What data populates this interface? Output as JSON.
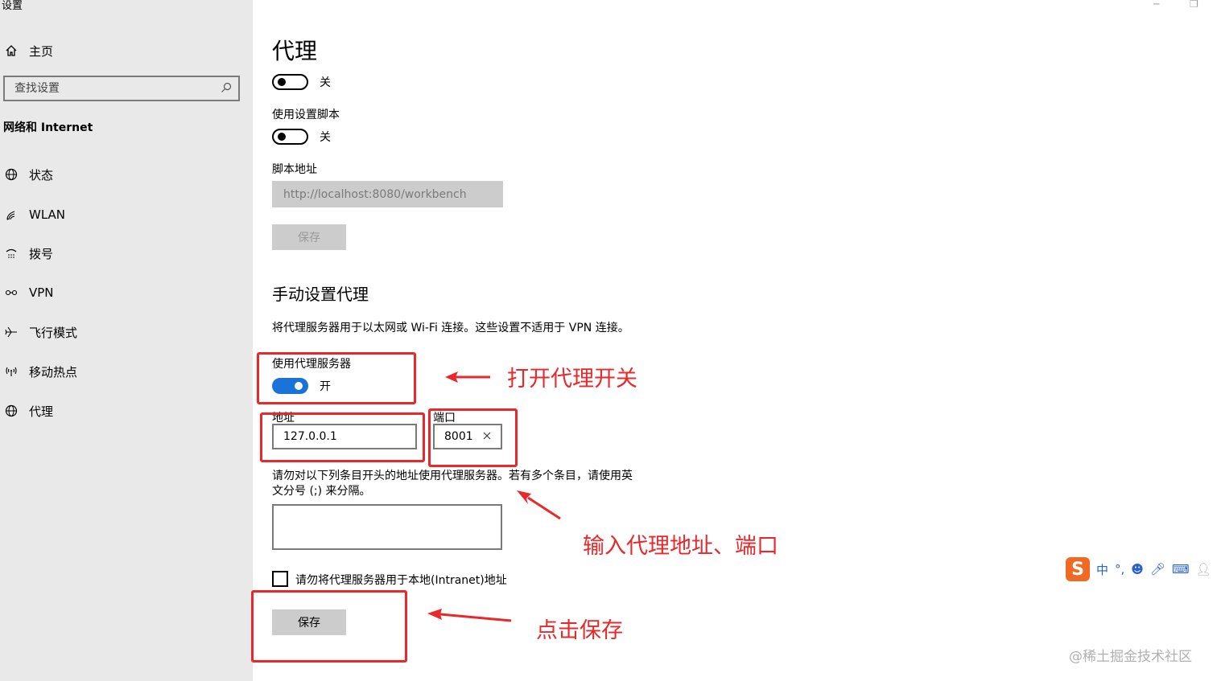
{
  "window": {
    "title": "设置",
    "minimize_icon": "minimize-icon",
    "restore_icon": "restore-icon"
  },
  "sidebar": {
    "home_label": "主页",
    "search_placeholder": "查找设置",
    "section_title": "网络和 Internet",
    "items": [
      {
        "label": "状态",
        "icon": "status-globe-icon"
      },
      {
        "label": "WLAN",
        "icon": "wifi-icon"
      },
      {
        "label": "拨号",
        "icon": "dialup-icon"
      },
      {
        "label": "VPN",
        "icon": "vpn-icon"
      },
      {
        "label": "飞行模式",
        "icon": "airplane-icon"
      },
      {
        "label": "移动热点",
        "icon": "hotspot-icon"
      },
      {
        "label": "代理",
        "icon": "proxy-globe-icon"
      }
    ]
  },
  "main": {
    "title": "代理",
    "auto_detect_state": "关",
    "script_label": "使用设置脚本",
    "script_state": "关",
    "script_address_label": "脚本地址",
    "script_address_value": "http://localhost:8080/workbench",
    "script_save_label": "保存",
    "manual_title": "手动设置代理",
    "manual_desc": "将代理服务器用于以太网或 Wi-Fi 连接。这些设置不适用于 VPN 连接。",
    "use_proxy_label": "使用代理服务器",
    "use_proxy_state": "开",
    "address_label": "地址",
    "address_value": "127.0.0.1",
    "port_label": "端口",
    "port_value": "8001",
    "exceptions_line1": "请勿对以下列条目开头的地址使用代理服务器。若有多个条目，请使用英",
    "exceptions_line2": "文分号 (;) 来分隔。",
    "exceptions_value": "",
    "local_checkbox_label": "请勿将代理服务器用于本地(Intranet)地址",
    "save_label": "保存"
  },
  "annotations": {
    "toggle_note": "打开代理开关",
    "address_note": "输入代理地址、端口",
    "save_note": "点击保存",
    "color": "#e8282b"
  },
  "ime": {
    "mode": "中",
    "logo": "S"
  },
  "watermark": "@稀土掘金技术社区",
  "colors": {
    "accent": "#1a73d9",
    "sidebar_bg": "#e9e9e9"
  }
}
